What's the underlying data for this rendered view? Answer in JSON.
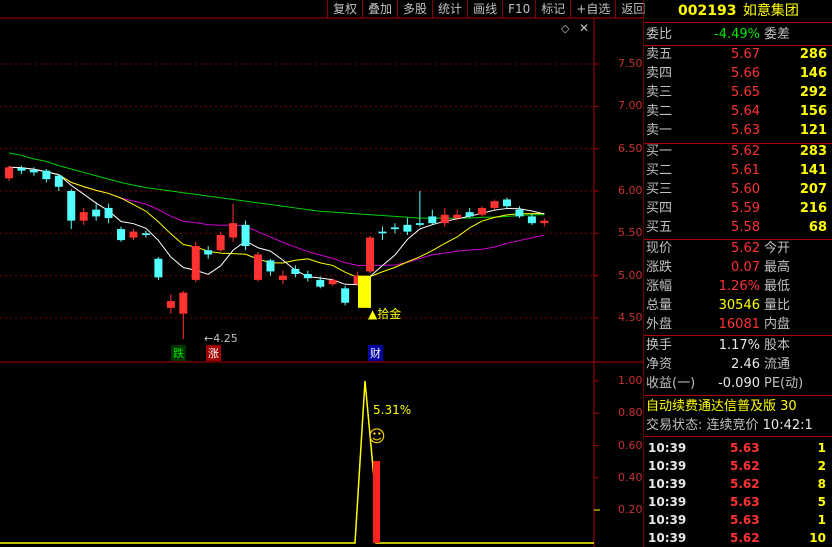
{
  "toolbar": {
    "items": [
      "复权",
      "叠加",
      "多股",
      "统计",
      "画线",
      "F10",
      "标记",
      "+自选",
      "返回"
    ]
  },
  "stock": {
    "code": "002193",
    "name": "如意集团"
  },
  "order_book": {
    "weibi_label": "委比",
    "weibi_value": "-4.49%",
    "weicha_label": "委差",
    "asks": [
      {
        "label": "卖五",
        "price": "5.67",
        "volume": "286"
      },
      {
        "label": "卖四",
        "price": "5.66",
        "volume": "146"
      },
      {
        "label": "卖三",
        "price": "5.65",
        "volume": "292"
      },
      {
        "label": "卖二",
        "price": "5.64",
        "volume": "156"
      },
      {
        "label": "卖一",
        "price": "5.63",
        "volume": "121"
      }
    ],
    "bids": [
      {
        "label": "买一",
        "price": "5.62",
        "volume": "283"
      },
      {
        "label": "买二",
        "price": "5.61",
        "volume": "141"
      },
      {
        "label": "买三",
        "price": "5.60",
        "volume": "207"
      },
      {
        "label": "买四",
        "price": "5.59",
        "volume": "216"
      },
      {
        "label": "买五",
        "price": "5.58",
        "volume": "68"
      }
    ]
  },
  "stats": {
    "rows": [
      {
        "l1": "现价",
        "v1": "5.62",
        "l2": "今开"
      },
      {
        "l1": "涨跌",
        "v1": "0.07",
        "l2": "最高"
      },
      {
        "l1": "涨幅",
        "v1": "1.26%",
        "l2": "最低"
      },
      {
        "l1": "总量",
        "v1": "30546",
        "l2": "量比"
      },
      {
        "l1": "外盘",
        "v1": "16081",
        "l2": "内盘"
      }
    ],
    "rows2": [
      {
        "l1": "换手",
        "v1": "1.17%",
        "l2": "股本"
      },
      {
        "l1": "净资",
        "v1": "2.46",
        "l2": "流通"
      },
      {
        "l1": "收益(一)",
        "v1": "-0.090",
        "l2": "PE(动)"
      }
    ]
  },
  "info": {
    "line1": "自动续费通达信普及版 30",
    "status_label": "交易状态: 连续竞价",
    "status_time": "10:42:1"
  },
  "ticks": [
    {
      "time": "10:39",
      "price": "5.63",
      "vol": "1"
    },
    {
      "time": "10:39",
      "price": "5.62",
      "vol": "2"
    },
    {
      "time": "10:39",
      "price": "5.62",
      "vol": "8"
    },
    {
      "time": "10:39",
      "price": "5.63",
      "vol": "5"
    },
    {
      "time": "10:39",
      "price": "5.63",
      "vol": "1"
    },
    {
      "time": "10:39",
      "price": "5.62",
      "vol": "10"
    }
  ],
  "chart_data": [
    {
      "type": "candlestick",
      "yticks": [
        "7.50",
        "7.00",
        "6.50",
        "6.00",
        "5.50",
        "5.00",
        "4.50"
      ],
      "ylim": [
        4.3,
        7.8
      ],
      "candles": [
        {
          "o": 6.15,
          "c": 6.28,
          "h": 6.3,
          "l": 6.12,
          "up": true
        },
        {
          "o": 6.24,
          "c": 6.27,
          "h": 6.3,
          "l": 6.2,
          "up": false
        },
        {
          "o": 6.25,
          "c": 6.22,
          "h": 6.28,
          "l": 6.18,
          "up": false
        },
        {
          "o": 6.24,
          "c": 6.14,
          "h": 6.26,
          "l": 6.1,
          "up": false
        },
        {
          "o": 6.18,
          "c": 6.05,
          "h": 6.2,
          "l": 6.0,
          "up": false
        },
        {
          "o": 6.0,
          "c": 5.65,
          "h": 6.02,
          "l": 5.55,
          "up": false
        },
        {
          "o": 5.65,
          "c": 5.75,
          "h": 5.8,
          "l": 5.6,
          "up": true
        },
        {
          "o": 5.78,
          "c": 5.7,
          "h": 5.85,
          "l": 5.65,
          "up": false
        },
        {
          "o": 5.8,
          "c": 5.68,
          "h": 5.85,
          "l": 5.62,
          "up": false
        },
        {
          "o": 5.55,
          "c": 5.42,
          "h": 5.58,
          "l": 5.4,
          "up": false
        },
        {
          "o": 5.45,
          "c": 5.52,
          "h": 5.55,
          "l": 5.42,
          "up": true
        },
        {
          "o": 5.5,
          "c": 5.48,
          "h": 5.53,
          "l": 5.45,
          "up": false
        },
        {
          "o": 5.2,
          "c": 4.98,
          "h": 5.22,
          "l": 4.95,
          "up": false
        },
        {
          "o": 4.62,
          "c": 4.7,
          "h": 4.78,
          "l": 4.55,
          "up": true
        },
        {
          "o": 4.55,
          "c": 4.8,
          "h": 4.82,
          "l": 4.25,
          "up": true
        },
        {
          "o": 4.95,
          "c": 5.35,
          "h": 5.4,
          "l": 4.92,
          "up": true
        },
        {
          "o": 5.3,
          "c": 5.25,
          "h": 5.35,
          "l": 5.2,
          "up": false
        },
        {
          "o": 5.3,
          "c": 5.48,
          "h": 5.52,
          "l": 5.28,
          "up": true
        },
        {
          "o": 5.45,
          "c": 5.62,
          "h": 5.85,
          "l": 5.4,
          "up": true
        },
        {
          "o": 5.6,
          "c": 5.35,
          "h": 5.65,
          "l": 5.3,
          "up": false
        },
        {
          "o": 5.25,
          "c": 4.95,
          "h": 5.28,
          "l": 4.93,
          "up": true
        },
        {
          "o": 5.18,
          "c": 5.05,
          "h": 5.2,
          "l": 5.0,
          "up": false
        },
        {
          "o": 5.0,
          "c": 4.95,
          "h": 5.06,
          "l": 4.9,
          "up": true
        },
        {
          "o": 5.08,
          "c": 5.02,
          "h": 5.12,
          "l": 4.98,
          "up": false
        },
        {
          "o": 5.02,
          "c": 4.97,
          "h": 5.06,
          "l": 4.93,
          "up": false
        },
        {
          "o": 4.95,
          "c": 4.87,
          "h": 4.99,
          "l": 4.85,
          "up": false
        },
        {
          "o": 4.9,
          "c": 4.95,
          "h": 4.97,
          "l": 4.88,
          "up": true
        },
        {
          "o": 4.85,
          "c": 4.68,
          "h": 4.88,
          "l": 4.65,
          "up": false
        },
        {
          "o": 4.9,
          "c": 5.0,
          "h": 5.05,
          "l": 4.88,
          "up": true
        },
        {
          "o": 5.05,
          "c": 5.45,
          "h": 5.47,
          "l": 5.03,
          "up": true
        },
        {
          "o": 5.5,
          "c": 5.52,
          "h": 5.58,
          "l": 5.42,
          "up": false
        },
        {
          "o": 5.55,
          "c": 5.57,
          "h": 5.62,
          "l": 5.5,
          "up": false
        },
        {
          "o": 5.52,
          "c": 5.6,
          "h": 5.68,
          "l": 5.48,
          "up": false
        },
        {
          "o": 5.6,
          "c": 5.62,
          "h": 6.0,
          "l": 5.58,
          "up": false
        },
        {
          "o": 5.62,
          "c": 5.7,
          "h": 5.78,
          "l": 5.6,
          "up": false
        },
        {
          "o": 5.62,
          "c": 5.72,
          "h": 5.8,
          "l": 5.58,
          "up": true
        },
        {
          "o": 5.68,
          "c": 5.72,
          "h": 5.78,
          "l": 5.65,
          "up": true
        },
        {
          "o": 5.7,
          "c": 5.75,
          "h": 5.8,
          "l": 5.68,
          "up": false
        },
        {
          "o": 5.72,
          "c": 5.8,
          "h": 5.82,
          "l": 5.7,
          "up": true
        },
        {
          "o": 5.8,
          "c": 5.88,
          "h": 5.9,
          "l": 5.78,
          "up": true
        },
        {
          "o": 5.9,
          "c": 5.82,
          "h": 5.92,
          "l": 5.8,
          "up": false
        },
        {
          "o": 5.78,
          "c": 5.7,
          "h": 5.82,
          "l": 5.68,
          "up": false
        },
        {
          "o": 5.7,
          "c": 5.62,
          "h": 5.73,
          "l": 5.6,
          "up": false
        },
        {
          "o": 5.65,
          "c": 5.62,
          "h": 5.68,
          "l": 5.58,
          "up": true
        }
      ],
      "annotations": {
        "low_label": "4.25",
        "marker_label": "拾金",
        "tags": [
          "跌",
          "涨",
          "财"
        ]
      }
    },
    {
      "type": "line",
      "yticks": [
        "1.00",
        "0.80",
        "0.60",
        "0.40",
        "0.20"
      ],
      "ylim": [
        0,
        1.1
      ],
      "label": "5.31%",
      "smiley": "☺"
    }
  ]
}
